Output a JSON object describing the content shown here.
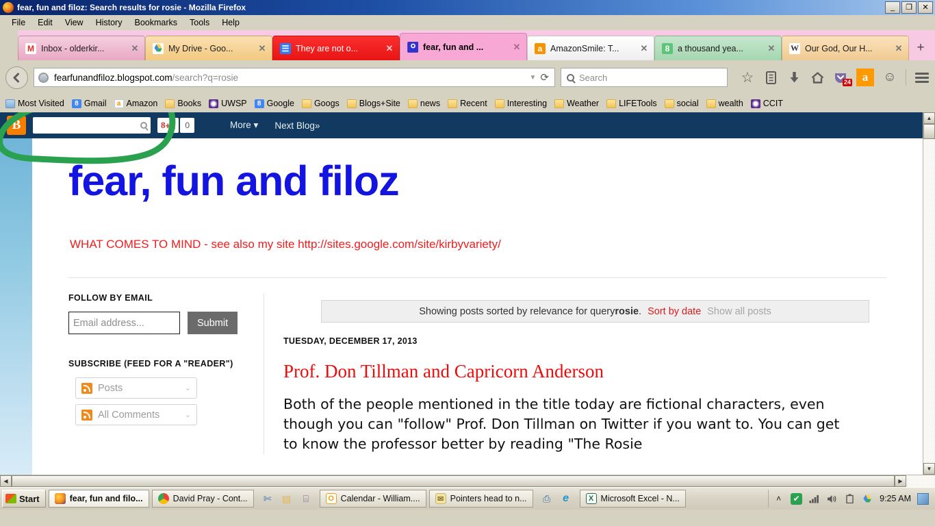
{
  "window": {
    "title": "fear, fun and filoz: Search results for rosie - Mozilla Firefox",
    "minimize": "_",
    "restore": "❐",
    "close": "✕"
  },
  "menubar": {
    "items": [
      "File",
      "Edit",
      "View",
      "History",
      "Bookmarks",
      "Tools",
      "Help"
    ]
  },
  "tabs": [
    {
      "label": "Inbox - olderkir...",
      "icon": "gmail-icon",
      "glyph": "M",
      "close": "✕",
      "active": false
    },
    {
      "label": "My Drive - Goo...",
      "icon": "google-drive-icon",
      "glyph": "▲",
      "close": "✕",
      "active": false
    },
    {
      "label": "They are not o...",
      "icon": "google-docs-icon",
      "glyph": "☰",
      "close": "✕",
      "active": false
    },
    {
      "label": "fear, fun and ...",
      "icon": "blogger-icon",
      "glyph": "■",
      "close": "✕",
      "active": true
    },
    {
      "label": "AmazonSmile: T...",
      "icon": "amazon-icon",
      "glyph": "a",
      "close": "✕",
      "active": false
    },
    {
      "label": "a thousand yea...",
      "icon": "google-icon",
      "glyph": "8",
      "close": "✕",
      "active": false
    },
    {
      "label": "Our God, Our H...",
      "icon": "wikipedia-icon",
      "glyph": "W",
      "close": "✕",
      "active": false
    }
  ],
  "newtab_label": "+",
  "navbar": {
    "back_glyph": "←",
    "url_bold": "fearfunandfiloz.blogspot.com",
    "url_dim": "/search?q=rosie",
    "dropdown_glyph": "▼",
    "reload_glyph": "⟳",
    "search_placeholder": "Search",
    "icons": [
      {
        "name": "bookmark-star-icon",
        "glyph": "☆"
      },
      {
        "name": "reading-list-icon",
        "glyph": "ὌB"
      },
      {
        "name": "downloads-icon",
        "glyph": "⬇"
      },
      {
        "name": "home-icon",
        "glyph": "⌂"
      }
    ],
    "pocket_badge": "24",
    "amazon_glyph": "a",
    "smiley_glyph": "☺",
    "menu_glyph": "☰"
  },
  "bookmarks": [
    {
      "label": "Most Visited",
      "icon": "most-visited-icon",
      "glyph": ""
    },
    {
      "label": "Gmail",
      "icon": "google-icon",
      "glyph": "8"
    },
    {
      "label": "Amazon",
      "icon": "amazon-icon",
      "glyph": "a"
    },
    {
      "label": "Books",
      "icon": "folder-icon",
      "glyph": ""
    },
    {
      "label": "UWSP",
      "icon": "uwsp-icon",
      "glyph": ""
    },
    {
      "label": "Google",
      "icon": "google-icon",
      "glyph": "8"
    },
    {
      "label": "Googs",
      "icon": "folder-icon",
      "glyph": ""
    },
    {
      "label": "Blogs+Site",
      "icon": "folder-icon",
      "glyph": ""
    },
    {
      "label": "news",
      "icon": "folder-icon",
      "glyph": ""
    },
    {
      "label": "Recent",
      "icon": "folder-icon",
      "glyph": ""
    },
    {
      "label": "Interesting",
      "icon": "folder-icon",
      "glyph": ""
    },
    {
      "label": "Weather",
      "icon": "folder-icon",
      "glyph": ""
    },
    {
      "label": "LIFETools",
      "icon": "folder-icon",
      "glyph": ""
    },
    {
      "label": "social",
      "icon": "folder-icon",
      "glyph": ""
    },
    {
      "label": "wealth",
      "icon": "folder-icon",
      "glyph": ""
    },
    {
      "label": "CCIT",
      "icon": "uwsp-icon",
      "glyph": ""
    }
  ],
  "blogger_navbar": {
    "logo_glyph": "B",
    "search_value": "",
    "plusone_g": "8",
    "plusone_p": "+1",
    "plusone_count": "0",
    "more_label": "More",
    "more_caret": "▾",
    "next_blog_label": "Next Blog»"
  },
  "blog": {
    "title": "fear, fun and filoz",
    "description": "WHAT COMES TO MIND - see also my site http://sites.google.com/site/kirbyvariety/"
  },
  "sidebar": {
    "follow_heading": "FOLLOW BY EMAIL",
    "email_placeholder": "Email address...",
    "submit_label": "Submit",
    "subscribe_heading": "SUBSCRIBE (FEED FOR A \"READER\")",
    "feeds": [
      {
        "label": "Posts",
        "caret": "⌄"
      },
      {
        "label": "All Comments",
        "caret": "⌄"
      }
    ]
  },
  "main": {
    "status_prefix": "Showing posts sorted by relevance for query ",
    "status_query": "rosie",
    "status_suffix": ".",
    "sort_by_date": "Sort by date",
    "show_all_posts": "Show all posts",
    "post_date": "TUESDAY, DECEMBER 17, 2013",
    "post_title": "Prof. Don Tillman and Capricorn Anderson",
    "post_body": "Both of the people mentioned in the title today are fictional characters, even though you can \"follow\" Prof. Don Tillman on Twitter if you want to. You can get to know the professor better by reading \"The Rosie"
  },
  "scrollbars": {
    "up": "▲",
    "down": "▼",
    "left": "◀",
    "right": "▶"
  },
  "taskbar": {
    "start_label": "Start",
    "items": [
      {
        "label": "fear, fun and filo...",
        "icon": "firefox-icon",
        "glyph": "●",
        "color": "#e8701a",
        "active": true
      },
      {
        "label": "David Pray - Cont...",
        "icon": "chrome-icon",
        "glyph": "●",
        "color": "#34a853",
        "active": false
      },
      {
        "label": "Calendar - William....",
        "icon": "outlook-icon",
        "glyph": "O",
        "color": "#e8a31a",
        "active": false
      },
      {
        "label": "Pointers head to n...",
        "icon": "mail-icon",
        "glyph": "✉",
        "color": "#e0c86a",
        "active": false
      },
      {
        "label": "Microsoft Excel - N...",
        "icon": "excel-icon",
        "glyph": "X",
        "color": "#1f7244",
        "active": false
      }
    ],
    "quick_icons": [
      {
        "name": "snipping-tool-icon",
        "glyph": "✄",
        "color": "#3b6fb5"
      },
      {
        "name": "file-explorer-icon",
        "glyph": "▤",
        "color": "#e5b64a"
      },
      {
        "name": "calculator-icon",
        "glyph": "⌸",
        "color": "#8b5ea8"
      }
    ],
    "quick_icons2": [
      {
        "name": "printer-icon",
        "glyph": "⎙",
        "color": "#3b6fb5"
      },
      {
        "name": "internet-explorer-icon",
        "glyph": "e",
        "color": "#2196d4"
      }
    ],
    "tray_icons": [
      {
        "name": "show-hidden-icons-icon",
        "glyph": "˄"
      },
      {
        "name": "antivirus-icon",
        "glyph": "✔"
      },
      {
        "name": "network-icon",
        "glyph": "▂"
      },
      {
        "name": "volume-icon",
        "glyph": "ὐA"
      },
      {
        "name": "battery-icon",
        "glyph": "▯"
      },
      {
        "name": "google-drive-tray-icon",
        "glyph": "▲"
      }
    ],
    "clock": "9:25 AM",
    "show_desktop": ""
  },
  "colors": {
    "title_blue": "#1414e0",
    "desc_red": "#f21b1b",
    "post_red": "#f00b0b",
    "blogger_navy": "#12395f",
    "annotation_green": "#2aa14f",
    "tab_active_pink": "#f7a8d4"
  }
}
